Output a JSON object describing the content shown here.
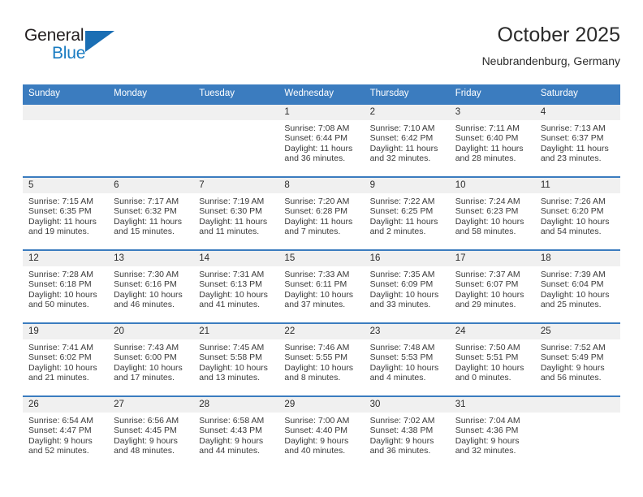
{
  "brand": {
    "name_part1": "General",
    "name_part2": "Blue",
    "accent_color": "#1a7cc2",
    "logo_icon": "triangle-flag-icon"
  },
  "header": {
    "title": "October 2025",
    "location": "Neubrandenburg, Germany"
  },
  "theme": {
    "header_blue": "#3b7cbf",
    "date_strip_gray": "#f0f0f0",
    "text_dark": "#2b2b2b"
  },
  "weekdays": [
    "Sunday",
    "Monday",
    "Tuesday",
    "Wednesday",
    "Thursday",
    "Friday",
    "Saturday"
  ],
  "labels": {
    "sunrise_prefix": "Sunrise:",
    "sunset_prefix": "Sunset:",
    "daylight_prefix": "Daylight:"
  },
  "weeks": [
    [
      {
        "date": "",
        "sunrise": "",
        "sunset": "",
        "daylight_line1": "",
        "daylight_line2": ""
      },
      {
        "date": "",
        "sunrise": "",
        "sunset": "",
        "daylight_line1": "",
        "daylight_line2": ""
      },
      {
        "date": "",
        "sunrise": "",
        "sunset": "",
        "daylight_line1": "",
        "daylight_line2": ""
      },
      {
        "date": "1",
        "sunrise": "Sunrise: 7:08 AM",
        "sunset": "Sunset: 6:44 PM",
        "daylight_line1": "Daylight: 11 hours",
        "daylight_line2": "and 36 minutes."
      },
      {
        "date": "2",
        "sunrise": "Sunrise: 7:10 AM",
        "sunset": "Sunset: 6:42 PM",
        "daylight_line1": "Daylight: 11 hours",
        "daylight_line2": "and 32 minutes."
      },
      {
        "date": "3",
        "sunrise": "Sunrise: 7:11 AM",
        "sunset": "Sunset: 6:40 PM",
        "daylight_line1": "Daylight: 11 hours",
        "daylight_line2": "and 28 minutes."
      },
      {
        "date": "4",
        "sunrise": "Sunrise: 7:13 AM",
        "sunset": "Sunset: 6:37 PM",
        "daylight_line1": "Daylight: 11 hours",
        "daylight_line2": "and 23 minutes."
      }
    ],
    [
      {
        "date": "5",
        "sunrise": "Sunrise: 7:15 AM",
        "sunset": "Sunset: 6:35 PM",
        "daylight_line1": "Daylight: 11 hours",
        "daylight_line2": "and 19 minutes."
      },
      {
        "date": "6",
        "sunrise": "Sunrise: 7:17 AM",
        "sunset": "Sunset: 6:32 PM",
        "daylight_line1": "Daylight: 11 hours",
        "daylight_line2": "and 15 minutes."
      },
      {
        "date": "7",
        "sunrise": "Sunrise: 7:19 AM",
        "sunset": "Sunset: 6:30 PM",
        "daylight_line1": "Daylight: 11 hours",
        "daylight_line2": "and 11 minutes."
      },
      {
        "date": "8",
        "sunrise": "Sunrise: 7:20 AM",
        "sunset": "Sunset: 6:28 PM",
        "daylight_line1": "Daylight: 11 hours",
        "daylight_line2": "and 7 minutes."
      },
      {
        "date": "9",
        "sunrise": "Sunrise: 7:22 AM",
        "sunset": "Sunset: 6:25 PM",
        "daylight_line1": "Daylight: 11 hours",
        "daylight_line2": "and 2 minutes."
      },
      {
        "date": "10",
        "sunrise": "Sunrise: 7:24 AM",
        "sunset": "Sunset: 6:23 PM",
        "daylight_line1": "Daylight: 10 hours",
        "daylight_line2": "and 58 minutes."
      },
      {
        "date": "11",
        "sunrise": "Sunrise: 7:26 AM",
        "sunset": "Sunset: 6:20 PM",
        "daylight_line1": "Daylight: 10 hours",
        "daylight_line2": "and 54 minutes."
      }
    ],
    [
      {
        "date": "12",
        "sunrise": "Sunrise: 7:28 AM",
        "sunset": "Sunset: 6:18 PM",
        "daylight_line1": "Daylight: 10 hours",
        "daylight_line2": "and 50 minutes."
      },
      {
        "date": "13",
        "sunrise": "Sunrise: 7:30 AM",
        "sunset": "Sunset: 6:16 PM",
        "daylight_line1": "Daylight: 10 hours",
        "daylight_line2": "and 46 minutes."
      },
      {
        "date": "14",
        "sunrise": "Sunrise: 7:31 AM",
        "sunset": "Sunset: 6:13 PM",
        "daylight_line1": "Daylight: 10 hours",
        "daylight_line2": "and 41 minutes."
      },
      {
        "date": "15",
        "sunrise": "Sunrise: 7:33 AM",
        "sunset": "Sunset: 6:11 PM",
        "daylight_line1": "Daylight: 10 hours",
        "daylight_line2": "and 37 minutes."
      },
      {
        "date": "16",
        "sunrise": "Sunrise: 7:35 AM",
        "sunset": "Sunset: 6:09 PM",
        "daylight_line1": "Daylight: 10 hours",
        "daylight_line2": "and 33 minutes."
      },
      {
        "date": "17",
        "sunrise": "Sunrise: 7:37 AM",
        "sunset": "Sunset: 6:07 PM",
        "daylight_line1": "Daylight: 10 hours",
        "daylight_line2": "and 29 minutes."
      },
      {
        "date": "18",
        "sunrise": "Sunrise: 7:39 AM",
        "sunset": "Sunset: 6:04 PM",
        "daylight_line1": "Daylight: 10 hours",
        "daylight_line2": "and 25 minutes."
      }
    ],
    [
      {
        "date": "19",
        "sunrise": "Sunrise: 7:41 AM",
        "sunset": "Sunset: 6:02 PM",
        "daylight_line1": "Daylight: 10 hours",
        "daylight_line2": "and 21 minutes."
      },
      {
        "date": "20",
        "sunrise": "Sunrise: 7:43 AM",
        "sunset": "Sunset: 6:00 PM",
        "daylight_line1": "Daylight: 10 hours",
        "daylight_line2": "and 17 minutes."
      },
      {
        "date": "21",
        "sunrise": "Sunrise: 7:45 AM",
        "sunset": "Sunset: 5:58 PM",
        "daylight_line1": "Daylight: 10 hours",
        "daylight_line2": "and 13 minutes."
      },
      {
        "date": "22",
        "sunrise": "Sunrise: 7:46 AM",
        "sunset": "Sunset: 5:55 PM",
        "daylight_line1": "Daylight: 10 hours",
        "daylight_line2": "and 8 minutes."
      },
      {
        "date": "23",
        "sunrise": "Sunrise: 7:48 AM",
        "sunset": "Sunset: 5:53 PM",
        "daylight_line1": "Daylight: 10 hours",
        "daylight_line2": "and 4 minutes."
      },
      {
        "date": "24",
        "sunrise": "Sunrise: 7:50 AM",
        "sunset": "Sunset: 5:51 PM",
        "daylight_line1": "Daylight: 10 hours",
        "daylight_line2": "and 0 minutes."
      },
      {
        "date": "25",
        "sunrise": "Sunrise: 7:52 AM",
        "sunset": "Sunset: 5:49 PM",
        "daylight_line1": "Daylight: 9 hours",
        "daylight_line2": "and 56 minutes."
      }
    ],
    [
      {
        "date": "26",
        "sunrise": "Sunrise: 6:54 AM",
        "sunset": "Sunset: 4:47 PM",
        "daylight_line1": "Daylight: 9 hours",
        "daylight_line2": "and 52 minutes."
      },
      {
        "date": "27",
        "sunrise": "Sunrise: 6:56 AM",
        "sunset": "Sunset: 4:45 PM",
        "daylight_line1": "Daylight: 9 hours",
        "daylight_line2": "and 48 minutes."
      },
      {
        "date": "28",
        "sunrise": "Sunrise: 6:58 AM",
        "sunset": "Sunset: 4:43 PM",
        "daylight_line1": "Daylight: 9 hours",
        "daylight_line2": "and 44 minutes."
      },
      {
        "date": "29",
        "sunrise": "Sunrise: 7:00 AM",
        "sunset": "Sunset: 4:40 PM",
        "daylight_line1": "Daylight: 9 hours",
        "daylight_line2": "and 40 minutes."
      },
      {
        "date": "30",
        "sunrise": "Sunrise: 7:02 AM",
        "sunset": "Sunset: 4:38 PM",
        "daylight_line1": "Daylight: 9 hours",
        "daylight_line2": "and 36 minutes."
      },
      {
        "date": "31",
        "sunrise": "Sunrise: 7:04 AM",
        "sunset": "Sunset: 4:36 PM",
        "daylight_line1": "Daylight: 9 hours",
        "daylight_line2": "and 32 minutes."
      },
      {
        "date": "",
        "sunrise": "",
        "sunset": "",
        "daylight_line1": "",
        "daylight_line2": ""
      }
    ]
  ]
}
